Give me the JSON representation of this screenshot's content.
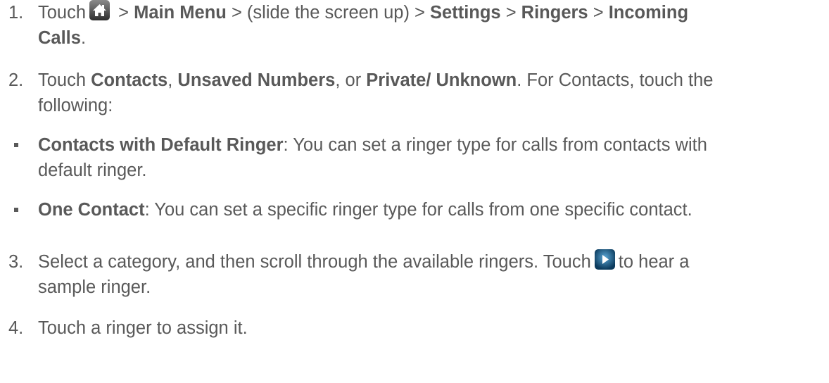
{
  "steps": [
    {
      "num": "1.",
      "parts": {
        "touch": "Touch",
        "sep1": " > ",
        "main_menu": "Main Menu",
        "sep2": " > (slide the screen up) > ",
        "settings": "Settings",
        "sep3": " > ",
        "ringers": "Ringers",
        "sep4": " > ",
        "incoming": "Incoming",
        "calls": "Calls",
        "end": "."
      },
      "icon": "home-icon"
    },
    {
      "num": "2.",
      "parts": {
        "touch": "Touch ",
        "contacts": "Contacts",
        "comma1": ", ",
        "unsaved": "Unsaved Numbers",
        "comma2": ", or ",
        "private": "Private/ Unknown",
        "rest1": ". For Contacts, touch the",
        "rest2": "following:"
      }
    },
    {
      "num": "3.",
      "parts": {
        "text1": "Select a category, and then scroll through the available ringers. Touch",
        "text2": "to hear a",
        "text3": "sample ringer."
      },
      "icon": "play-icon"
    },
    {
      "num": "4.",
      "parts": {
        "text1": "Touch a ringer to assign it."
      }
    }
  ],
  "bullets": [
    {
      "bold": "Contacts with Default Ringer",
      "text1": ": You can set a ringer type for calls from contacts with",
      "text2": "default ringer."
    },
    {
      "bold": "One Contact",
      "text1": ": You can set a specific ringer type for calls from one specific contact."
    }
  ]
}
